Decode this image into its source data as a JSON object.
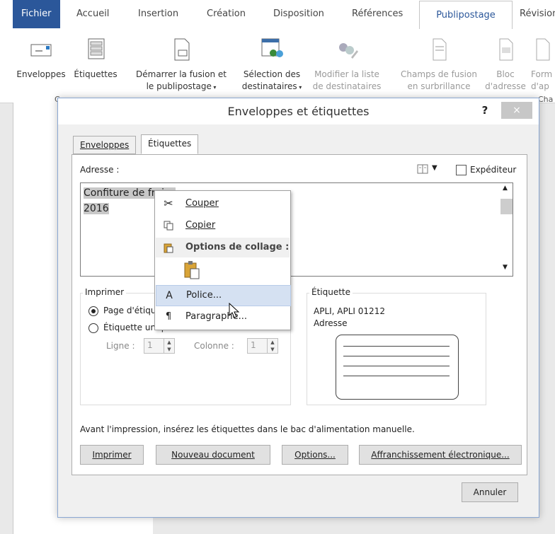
{
  "ribbon": {
    "tabs": {
      "file": "Fichier",
      "home": "Accueil",
      "insert": "Insertion",
      "design": "Création",
      "layout": "Disposition",
      "references": "Références",
      "mailings": "Publipostage",
      "review": "Révision"
    },
    "buttons": {
      "envelopes": "Enveloppes",
      "labels": "Étiquettes",
      "start_merge_1": "Démarrer la fusion et",
      "start_merge_2": "le publipostage",
      "select_recipients_1": "Sélection des",
      "select_recipients_2": "destinataires",
      "edit_list_1": "Modifier la liste",
      "edit_list_2": "de destinataires",
      "highlight_fields_1": "Champs de fusion",
      "highlight_fields_2": "en surbrillance",
      "address_block_1": "Bloc",
      "address_block_2": "d'adresse",
      "greeting_1": "Form",
      "greeting_2": "d'ap"
    },
    "groups": {
      "create_cut": "C",
      "write_cut": "Cha"
    }
  },
  "dialog": {
    "title": "Enveloppes et étiquettes",
    "help": "?",
    "close": "×",
    "tabs": {
      "envelopes": "Enveloppes",
      "labels": "Étiquettes"
    },
    "address_label": "Adresse :",
    "sender_label": "Expéditeur",
    "address_lines": [
      "Confiture de fraise",
      "2016"
    ],
    "print_group": {
      "legend": "Imprimer",
      "full_page": "Page d'étiquettes identiques",
      "single": "Étiquette unique",
      "row_label": "Ligne :",
      "row_value": "1",
      "col_label": "Colonne :",
      "col_value": "1"
    },
    "label_group": {
      "legend": "Étiquette",
      "vendor": "APLI, APLI 01212",
      "type": "Adresse"
    },
    "note": "Avant l'impression, insérez les étiquettes dans le bac d'alimentation manuelle.",
    "buttons": {
      "print": "Imprimer",
      "new_doc": "Nouveau document",
      "options": "Options...",
      "epostage": "Affranchissement électronique...",
      "cancel": "Annuler"
    }
  },
  "context_menu": {
    "cut": "Couper",
    "copy": "Copier",
    "paste_options": "Options de collage :",
    "font": "Police...",
    "paragraph": "Paragraphe..."
  },
  "colors": {
    "accent": "#2b579a",
    "menu_highlight": "#d5e1f2"
  }
}
